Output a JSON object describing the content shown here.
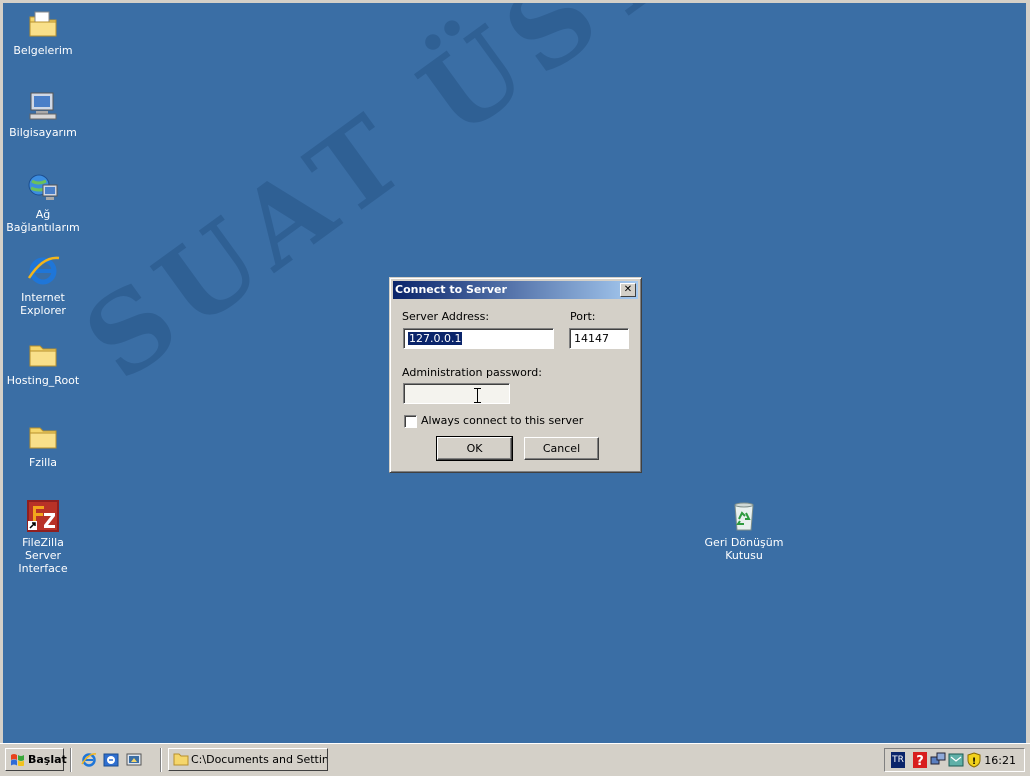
{
  "desktop": {
    "icons": [
      {
        "label": "Belgelerim",
        "icon": "my-documents-folder-icon"
      },
      {
        "label": "Bilgisayarım",
        "icon": "my-computer-icon"
      },
      {
        "label": "Ağ Bağlantılarım",
        "icon": "network-connections-icon"
      },
      {
        "label": "Internet Explorer",
        "icon": "internet-explorer-icon"
      },
      {
        "label": "Hosting_Root",
        "icon": "folder-icon"
      },
      {
        "label": "Fzilla",
        "icon": "folder-icon"
      },
      {
        "label": "FileZilla Server Interface",
        "icon": "filezilla-server-icon"
      },
      {
        "label": "Geri Dönüşüm Kutusu",
        "icon": "recycle-bin-icon"
      }
    ],
    "watermark": "SUAT ÜSTKAN"
  },
  "dialog": {
    "title": "Connect to Server",
    "server_address_label": "Server Address:",
    "server_address_value": "127.0.0.1",
    "port_label": "Port:",
    "port_value": "14147",
    "password_label": "Administration password:",
    "password_value": "",
    "always_connect_label": "Always connect to this server",
    "always_connect_checked": false,
    "ok_label": "OK",
    "cancel_label": "Cancel"
  },
  "taskbar": {
    "start_label": "Başlat",
    "task_item_label": "C:\\Documents and Settin...",
    "language": "TR",
    "clock": "16:21"
  },
  "colors": {
    "desktop": "#3a6ea5",
    "titlebar_start": "#0a246a",
    "titlebar_end": "#a6caf0",
    "face": "#d4d0c8"
  }
}
